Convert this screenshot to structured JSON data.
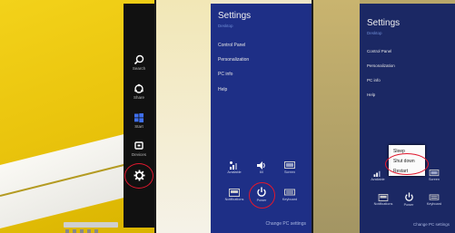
{
  "charms": {
    "items": [
      {
        "label": "Search",
        "icon": "search-icon"
      },
      {
        "label": "Share",
        "icon": "share-icon"
      },
      {
        "label": "Start",
        "icon": "windows-logo-icon"
      },
      {
        "label": "Devices",
        "icon": "devices-icon"
      },
      {
        "label": "Settings",
        "icon": "gear-icon"
      }
    ]
  },
  "settings_panel_1": {
    "title": "Settings",
    "subtitle": "Desktop",
    "links": [
      "Control Panel",
      "Personalization",
      "PC info",
      "Help"
    ],
    "tiles_row1": [
      "Available",
      "60",
      "Screen"
    ],
    "tiles_row2": [
      "Notifications",
      "Power",
      "Keyboard"
    ],
    "change_pc_settings": "Change PC settings"
  },
  "settings_panel_2": {
    "title": "Settings",
    "subtitle": "Desktop",
    "links": [
      "Control Panel",
      "Personalization",
      "PC info",
      "Help"
    ],
    "tiles_row1": [
      "Available",
      "",
      "Screen"
    ],
    "tiles_row2": [
      "Notifications",
      "Power",
      "Keyboard"
    ],
    "change_pc_settings": "Change PC settings"
  },
  "power_menu": {
    "items": [
      "Sleep",
      "Shut down",
      "Restart"
    ]
  },
  "colors": {
    "charm_bar": "#111111",
    "settings_bg": "#1e2f86",
    "highlight_circle": "#e0182e",
    "wallpaper": "#f3d21a"
  }
}
